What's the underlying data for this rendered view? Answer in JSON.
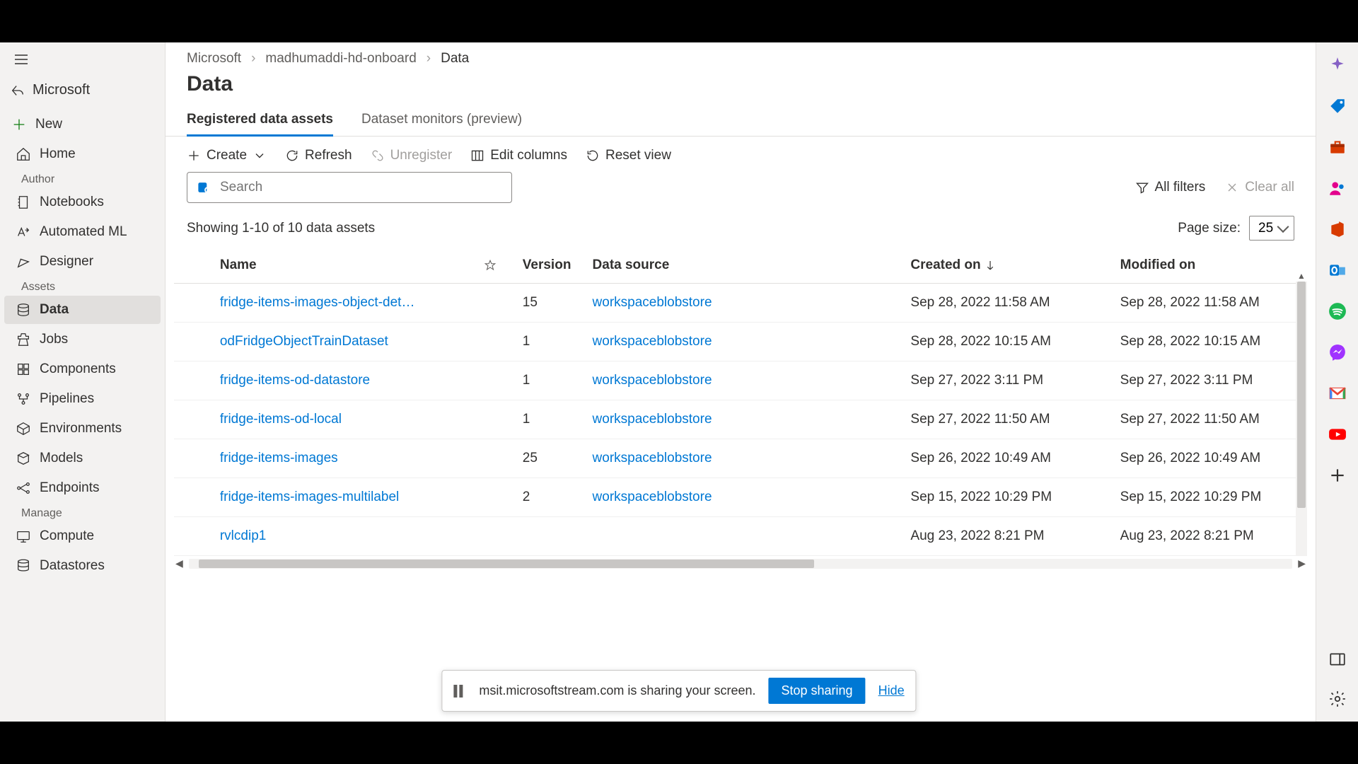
{
  "workspace": "Microsoft",
  "sidebar": {
    "new_label": "New",
    "home_label": "Home",
    "groups": {
      "author": {
        "label": "Author",
        "items": [
          "Notebooks",
          "Automated ML",
          "Designer"
        ]
      },
      "assets": {
        "label": "Assets",
        "items": [
          "Data",
          "Jobs",
          "Components",
          "Pipelines",
          "Environments",
          "Models",
          "Endpoints"
        ]
      },
      "manage": {
        "label": "Manage",
        "items": [
          "Compute",
          "Datastores"
        ]
      }
    },
    "active": "Data"
  },
  "breadcrumb": [
    "Microsoft",
    "madhumaddi-hd-onboard",
    "Data"
  ],
  "page_title": "Data",
  "tabs": [
    "Registered data assets",
    "Dataset monitors (preview)"
  ],
  "active_tab": 0,
  "toolbar": {
    "create": "Create",
    "refresh": "Refresh",
    "unregister": "Unregister",
    "edit_columns": "Edit columns",
    "reset_view": "Reset view"
  },
  "search_placeholder": "Search",
  "filters": {
    "all": "All filters",
    "clear": "Clear all"
  },
  "count_text": "Showing 1-10 of 10 data assets",
  "page_size_label": "Page size:",
  "page_size_value": "25",
  "columns": {
    "name": "Name",
    "version": "Version",
    "data_source": "Data source",
    "created": "Created on",
    "modified": "Modified on"
  },
  "sort_column": "created",
  "rows": [
    {
      "name": "fridge-items-images-object-det…",
      "version": "15",
      "data_source": "workspaceblobstore",
      "created": "Sep 28, 2022 11:58 AM",
      "modified": "Sep 28, 2022 11:58 AM"
    },
    {
      "name": "odFridgeObjectTrainDataset",
      "version": "1",
      "data_source": "workspaceblobstore",
      "created": "Sep 28, 2022 10:15 AM",
      "modified": "Sep 28, 2022 10:15 AM"
    },
    {
      "name": "fridge-items-od-datastore",
      "version": "1",
      "data_source": "workspaceblobstore",
      "created": "Sep 27, 2022 3:11 PM",
      "modified": "Sep 27, 2022 3:11 PM"
    },
    {
      "name": "fridge-items-od-local",
      "version": "1",
      "data_source": "workspaceblobstore",
      "created": "Sep 27, 2022 11:50 AM",
      "modified": "Sep 27, 2022 11:50 AM"
    },
    {
      "name": "fridge-items-images",
      "version": "25",
      "data_source": "workspaceblobstore",
      "created": "Sep 26, 2022 10:49 AM",
      "modified": "Sep 26, 2022 10:49 AM"
    },
    {
      "name": "fridge-items-images-multilabel",
      "version": "2",
      "data_source": "workspaceblobstore",
      "created": "Sep 15, 2022 10:29 PM",
      "modified": "Sep 15, 2022 10:29 PM"
    },
    {
      "name": "rvlcdip1",
      "version": "",
      "data_source": "",
      "created": "Aug 23, 2022 8:21 PM",
      "modified": "Aug 23, 2022 8:21 PM"
    }
  ],
  "share_bar": {
    "text": "msit.microsoftstream.com is sharing your screen.",
    "stop": "Stop sharing",
    "hide": "Hide"
  },
  "rail_icons": [
    "copilot",
    "tag",
    "briefcase",
    "people",
    "office",
    "outlook",
    "spotify",
    "messenger",
    "gmail",
    "youtube",
    "plus",
    "tablet",
    "settings"
  ]
}
